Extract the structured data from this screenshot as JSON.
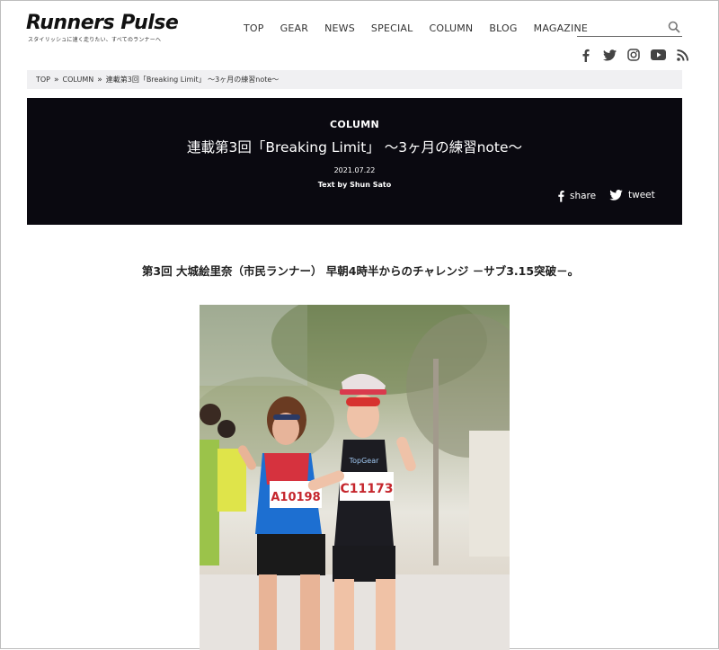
{
  "site": {
    "logo": "Runners Pulse",
    "tagline": "スタイリッシュに速く走りたい、すべてのランナーへ"
  },
  "nav": {
    "items": [
      "TOP",
      "GEAR",
      "NEWS",
      "SPECIAL",
      "COLUMN",
      "BLOG",
      "MAGAZINE"
    ]
  },
  "search": {
    "placeholder": ""
  },
  "social": {
    "icons": [
      "facebook-icon",
      "twitter-icon",
      "instagram-icon",
      "youtube-icon",
      "rss-icon"
    ]
  },
  "breadcrumb": {
    "items": [
      "TOP",
      "COLUMN",
      "連載第3回「Breaking Limit」 〜3ヶ月の練習note〜"
    ]
  },
  "article": {
    "category": "COLUMN",
    "title": "連載第3回「Breaking Limit」 〜3ヶ月の練習note〜",
    "date": "2021.07.22",
    "author": "Text by Shun Sato",
    "share_label": "share",
    "tweet_label": "tweet",
    "subtitle": "第3回 大城絵里奈（市民ランナー） 早朝4時半からのチャレンジ －サブ3.15突破－。"
  },
  "photo": {
    "bib_left": "A10198",
    "bib_right": "C11173",
    "shirt_text": "TopGear"
  },
  "colors": {
    "hero_bg": "#0a0910",
    "breadcrumb_bg": "#f0f0f2"
  }
}
